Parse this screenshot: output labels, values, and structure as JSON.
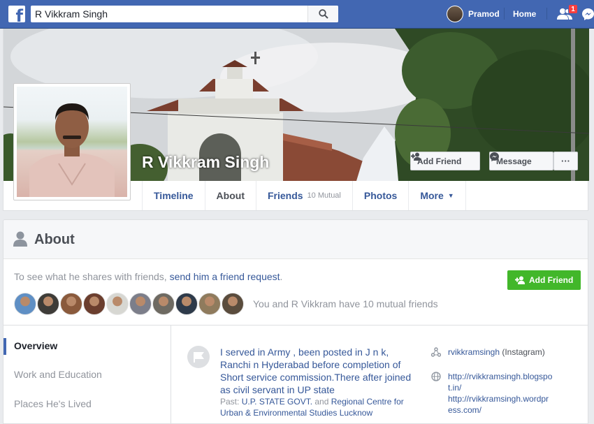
{
  "topbar": {
    "logo_letter": "f",
    "search_value": "R Vikkram Singh",
    "user_name": "Pramod",
    "home_label": "Home",
    "friend_requests_count": "1",
    "brand_color": "#4267b2"
  },
  "profile": {
    "name": "R Vikkram Singh",
    "add_friend_label": "Add Friend",
    "message_label": "Message",
    "more_label": "···"
  },
  "tabs": [
    {
      "label": "Timeline",
      "sub": ""
    },
    {
      "label": "About",
      "sub": ""
    },
    {
      "label": "Friends",
      "sub": "10 Mutual"
    },
    {
      "label": "Photos",
      "sub": ""
    },
    {
      "label": "More",
      "sub": ""
    }
  ],
  "about": {
    "title": "About",
    "friend_prompt": "To see what he shares with friends, ",
    "friend_link": "send him a friend request",
    "friend_prompt_end": ".",
    "add_friend_label": "Add Friend",
    "mutual_text": "You and R Vikkram have 10 mutual friends",
    "mutual_avatar_colors": [
      "#5f8fc4",
      "#3e3c38",
      "#8a5a3c",
      "#6b3e2e",
      "#d7d7d2",
      "#7c7e8a",
      "#6e6a62",
      "#2e3a4a",
      "#8f7b5d",
      "#5a4c3d"
    ],
    "side_nav": [
      "Overview",
      "Work and Education",
      "Places He's Lived"
    ],
    "work_text": "I served in Army , been posted in J n k, Ranchi n Hyderabad before completion of Short service commission.There after joined as civil servant in UP state",
    "past_label": "Past: ",
    "past_org1": "U.P. STATE GOVT.",
    "past_and": " and ",
    "past_org2": "Regional Centre for Urban & Environmental Studies Lucknow",
    "instagram_handle": "rvikkramsingh",
    "instagram_label": " (Instagram)",
    "website1": "http://rvikkramsingh.blogspot.in/",
    "website2": "http://rvikkramsingh.wordpress.com/"
  }
}
